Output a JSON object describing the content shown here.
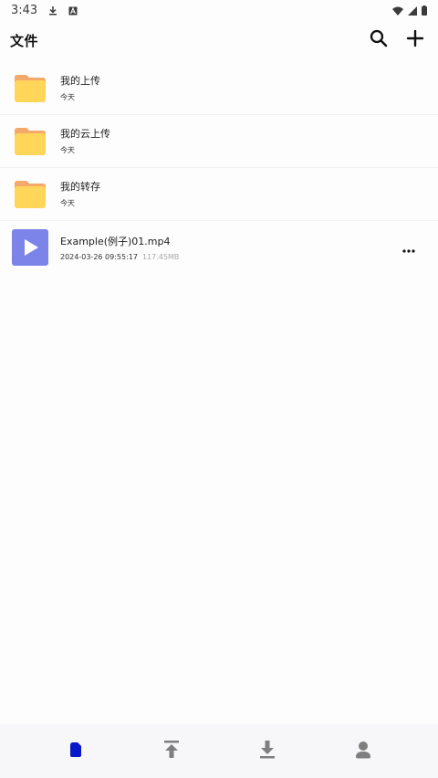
{
  "status_bar": {
    "time": "3:43",
    "icons": [
      "download-icon",
      "a-icon",
      "wifi-icon",
      "signal-icon",
      "battery-icon"
    ]
  },
  "header": {
    "title": "文件",
    "actions": [
      "search-icon",
      "add-icon"
    ]
  },
  "files": [
    {
      "name": "我的上传",
      "date": "今天",
      "type": "folder"
    },
    {
      "name": "我的云上传",
      "date": "今天",
      "type": "folder"
    },
    {
      "name": "我的转存",
      "date": "今天",
      "type": "folder"
    },
    {
      "name": "Example(例子)01.mp4",
      "date": "2024-03-26 09:55:17",
      "size": "117.45MB",
      "type": "video"
    }
  ],
  "bottom_nav": {
    "items": [
      {
        "icon": "file-icon",
        "active": true
      },
      {
        "icon": "upload-icon",
        "active": false
      },
      {
        "icon": "download-icon",
        "active": false
      },
      {
        "icon": "profile-icon",
        "active": false
      }
    ]
  },
  "colors": {
    "folder": "#FFD55A",
    "folder_tab": "#F4A86A",
    "video": "#7C84EA",
    "active_nav": "#0A17C8",
    "inactive_nav": "#7E7E7E"
  }
}
